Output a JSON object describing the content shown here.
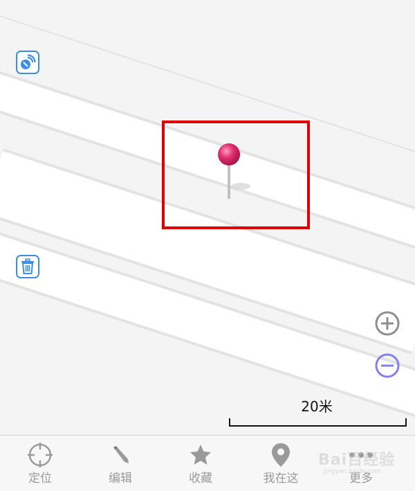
{
  "map": {
    "scale_label": "20米",
    "icons": {
      "gps_button": "satellite-signal-icon",
      "trash_button": "trash-icon",
      "zoom_in": "plus-circle-icon",
      "zoom_out": "minus-circle-icon",
      "marker": "pushpin-icon"
    },
    "colors": {
      "background": "#f4f4f4",
      "road": "#ffffff",
      "road_edge": "#e3e3e3",
      "accent_blue": "#3a8ee6",
      "highlight": "#e00000",
      "pin_head": "#e0306e",
      "zoom_in": "#8c8c8c",
      "zoom_out": "#8080f0"
    }
  },
  "tabs": [
    {
      "label": "定位",
      "icon": "crosshair-icon"
    },
    {
      "label": "编辑",
      "icon": "pencil-icon"
    },
    {
      "label": "收藏",
      "icon": "star-icon"
    },
    {
      "label": "我在这",
      "icon": "location-pin-icon"
    },
    {
      "label": "更多",
      "icon": "more-dots-icon"
    }
  ],
  "watermark": {
    "text": "Bai百经验",
    "subtext": "jingyan.baidu.com"
  }
}
